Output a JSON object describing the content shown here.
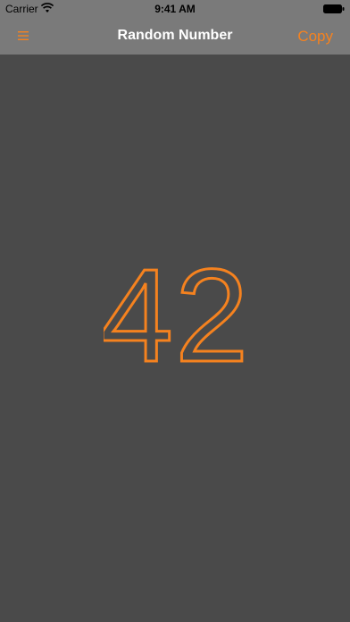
{
  "status_bar": {
    "carrier": "Carrier",
    "time": "9:41 AM"
  },
  "nav_bar": {
    "title": "Random Number",
    "menu_icon": "hamburger-menu-icon",
    "copy_label": "Copy"
  },
  "main": {
    "number": "42"
  },
  "colors": {
    "accent": "#f5821f",
    "background": "#4a4a4a",
    "bar": "#7a7a7a"
  }
}
